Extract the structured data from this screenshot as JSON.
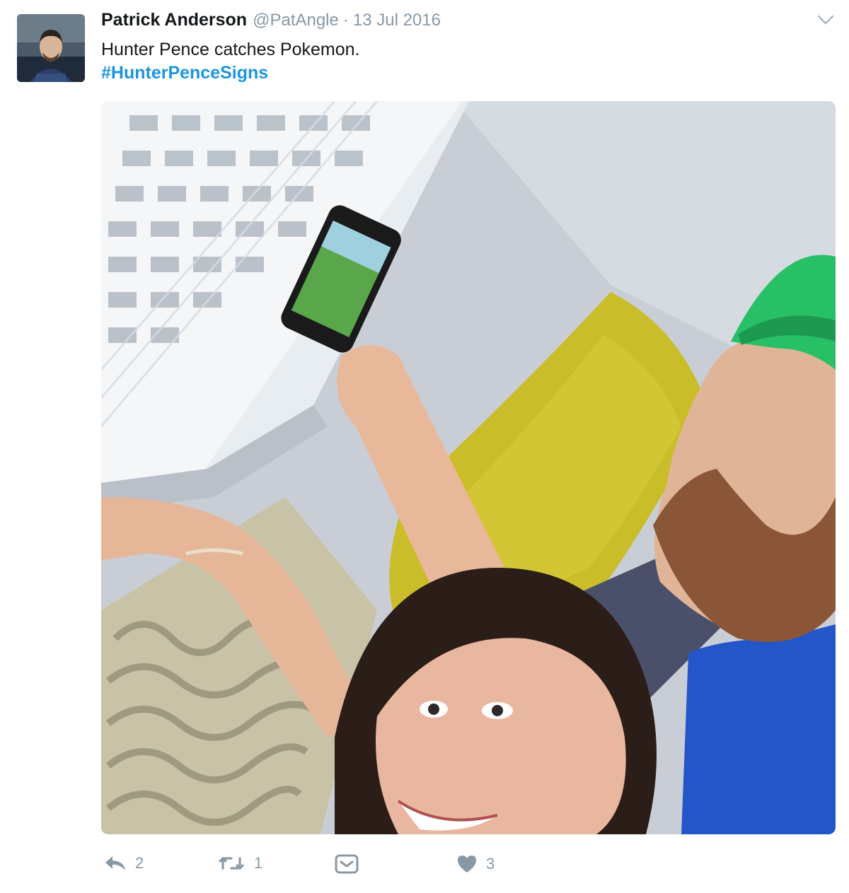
{
  "tweet": {
    "author": {
      "fullname": "Patrick Anderson",
      "username": "@PatAngle"
    },
    "separator": "·",
    "timestamp": "13 Jul 2016",
    "text": "Hunter Pence catches Pokemon.",
    "hashtag": "#HunterPenceSigns"
  },
  "actions": {
    "reply_count": "2",
    "retweet_count": "1",
    "like_count": "3"
  },
  "icons": {
    "reply": "reply-icon",
    "retweet": "retweet-icon",
    "direct_message": "inbox-icon",
    "like": "heart-icon",
    "menu": "chevron-down-icon"
  },
  "colors": {
    "text": "#14171a",
    "secondary": "#8899a6",
    "link": "#1b95e0",
    "icon": "#8899a6"
  }
}
